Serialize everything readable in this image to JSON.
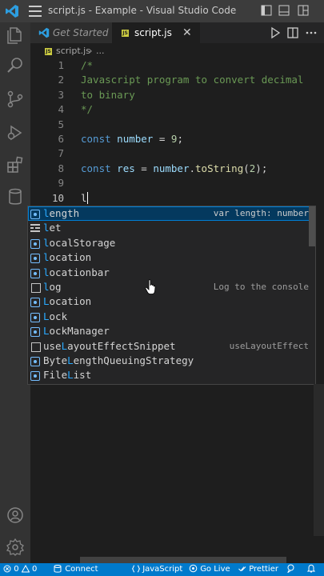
{
  "window": {
    "title": "script.js - Example - Visual Studio Code"
  },
  "tabs": [
    {
      "label": "Get Started"
    },
    {
      "label": "script.js",
      "close": "✕"
    }
  ],
  "breadcrumb": {
    "file": "script.js",
    "separator": "›",
    "more": "..."
  },
  "editor": {
    "lines": [
      {
        "n": "1",
        "text": "/*"
      },
      {
        "n": "2",
        "text": "Javascript program to convert decimal"
      },
      {
        "n": "3",
        "text": "to binary"
      },
      {
        "n": "4",
        "text": "*/"
      },
      {
        "n": "5",
        "text": ""
      },
      {
        "n": "6",
        "kw": "const",
        "var": "number",
        "op": " = ",
        "num": "9",
        "end": ";"
      },
      {
        "n": "7",
        "text": ""
      },
      {
        "n": "8",
        "kw": "const",
        "var": "res",
        "op": " = ",
        "obj": "number",
        "dot": ".",
        "fn": "toString",
        "open": "(",
        "num": "2",
        "close": ");"
      },
      {
        "n": "9",
        "text": ""
      },
      {
        "n": "10",
        "text": "l"
      }
    ]
  },
  "suggestions": [
    {
      "match": "l",
      "rest": "ength",
      "detail": "var length: number",
      "kind": "variable"
    },
    {
      "match": "l",
      "rest": "et",
      "detail": "",
      "kind": "keyword"
    },
    {
      "match": "l",
      "rest": "ocalStorage",
      "detail": "",
      "kind": "variable"
    },
    {
      "match": "l",
      "rest": "ocation",
      "detail": "",
      "kind": "variable"
    },
    {
      "match": "l",
      "rest": "ocationbar",
      "detail": "",
      "kind": "variable"
    },
    {
      "match": "l",
      "rest": "og",
      "detail": "Log to the console",
      "kind": "snippet"
    },
    {
      "match": "L",
      "rest": "ocation",
      "detail": "",
      "kind": "variable"
    },
    {
      "match": "L",
      "rest": "ock",
      "detail": "",
      "kind": "variable"
    },
    {
      "match": "L",
      "rest": "ockManager",
      "detail": "",
      "kind": "variable"
    },
    {
      "pre": "use",
      "match": "L",
      "rest": "ayoutEffectSnippet",
      "detail": "useLayoutEffect",
      "kind": "snippet"
    },
    {
      "pre": "Byte",
      "match": "L",
      "rest": "engthQueuingStrategy",
      "detail": "",
      "kind": "variable"
    },
    {
      "pre": "File",
      "match": "L",
      "rest": "ist",
      "detail": "",
      "kind": "variable"
    }
  ],
  "statusbar": {
    "errors": "0",
    "warnings": "0",
    "connect": "Connect",
    "language": "JavaScript",
    "golive": "Go Live",
    "prettier": "Prettier"
  },
  "colors": {
    "accent": "#007acc",
    "selection": "#04395e",
    "match": "#2aaaff"
  },
  "icons": [
    "vscode-logo-icon",
    "menu-icon",
    "explorer-icon",
    "search-icon",
    "source-control-icon",
    "run-debug-icon",
    "extensions-icon",
    "database-icon",
    "account-icon",
    "settings-gear-icon",
    "run-icon",
    "split-editor-icon",
    "more-icon"
  ]
}
